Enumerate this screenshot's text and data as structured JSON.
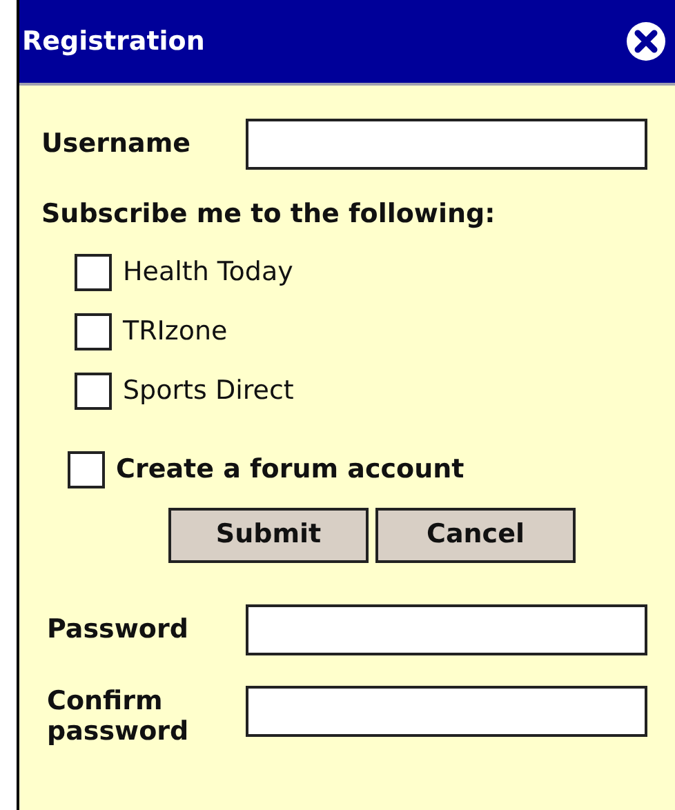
{
  "window": {
    "title": "Registration"
  },
  "username": {
    "label": "Username"
  },
  "subscribe": {
    "heading": "Subscribe me to the following:",
    "options": [
      {
        "label": "Health Today",
        "checked": false
      },
      {
        "label": "TRIzone",
        "checked": false
      },
      {
        "label": "Sports Direct",
        "checked": false
      }
    ]
  },
  "forum_account": {
    "label": "Create a forum account",
    "checked": false
  },
  "buttons": [
    "Submit",
    "Cancel"
  ],
  "password": {
    "label": "Password"
  },
  "confirm_password": {
    "label": "Confirm password"
  }
}
